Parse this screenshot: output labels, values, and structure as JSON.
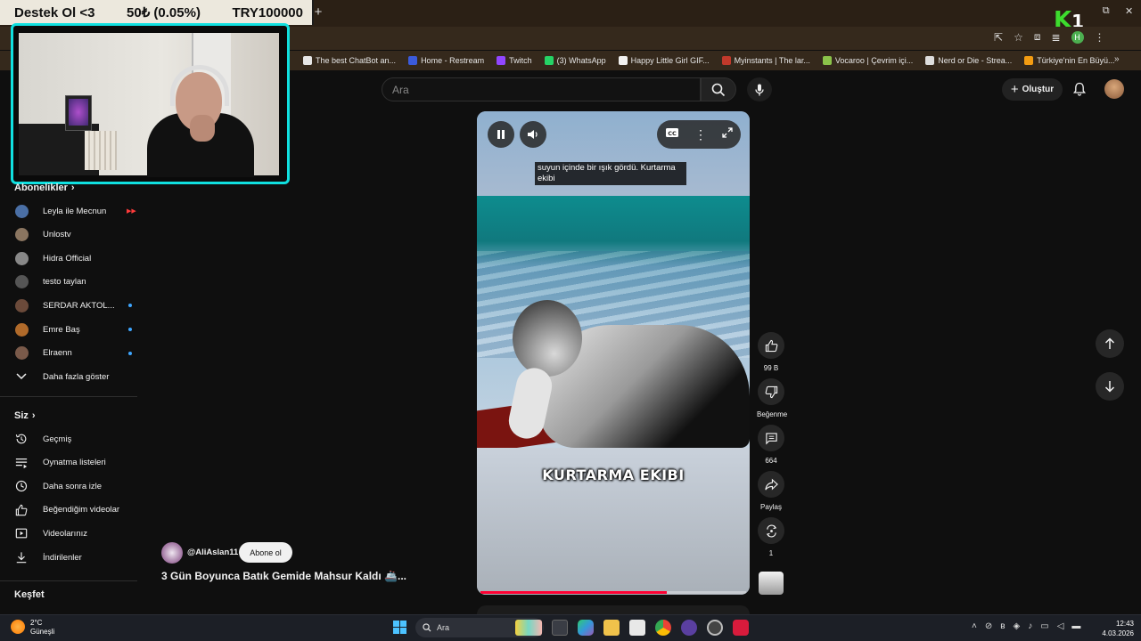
{
  "overlay": {
    "donation_label": "Destek Ol <3",
    "donation_amount": "50₺ (0.05%)",
    "donation_goal": "TRY100000",
    "new_tab": "+"
  },
  "bookmarks": [
    {
      "label": "The best ChatBot an...",
      "color": "#e6e6e6"
    },
    {
      "label": "Home - Restream",
      "color": "#3b5bdb"
    },
    {
      "label": "Twitch",
      "color": "#9146ff"
    },
    {
      "label": "(3) WhatsApp",
      "color": "#25d366"
    },
    {
      "label": "Happy Little Girl GIF...",
      "color": "#f1f1f1"
    },
    {
      "label": "Myinstants | The lar...",
      "color": "#c0392b"
    },
    {
      "label": "Vocaroo | Çevrim içi...",
      "color": "#8bc34a"
    },
    {
      "label": "Nerd or Die - Strea...",
      "color": "#dddddd"
    },
    {
      "label": "Türkiye'nin En Büyü...",
      "color": "#f39c12"
    }
  ],
  "bookmarks_more": "»",
  "header": {
    "search_placeholder": "Ara",
    "create_label": "Oluştur",
    "profile_initial": "H"
  },
  "sidebar": {
    "subscriptions_title": "Abonelikler",
    "channels": [
      {
        "name": "Leyla ile Mecnun",
        "color": "#4a6fa5",
        "live": true,
        "dot": false
      },
      {
        "name": "Unlostv",
        "color": "#8a7560",
        "live": false,
        "dot": false
      },
      {
        "name": "Hidra Official",
        "color": "#888888",
        "live": false,
        "dot": false
      },
      {
        "name": "testo taylan",
        "color": "#555555",
        "live": false,
        "dot": false
      },
      {
        "name": "SERDAR AKTOL...",
        "color": "#6b4a3a",
        "live": false,
        "dot": true
      },
      {
        "name": "Emre Baş",
        "color": "#b06a2a",
        "live": false,
        "dot": true
      },
      {
        "name": "Elraenn",
        "color": "#7a5a4a",
        "live": false,
        "dot": true
      }
    ],
    "show_more": "Daha fazla göster",
    "you_title": "Siz",
    "you_items": [
      {
        "label": "Geçmiş",
        "icon": "history-icon"
      },
      {
        "label": "Oynatma listeleri",
        "icon": "playlist-icon"
      },
      {
        "label": "Daha sonra izle",
        "icon": "clock-icon"
      },
      {
        "label": "Beğendiğim videolar",
        "icon": "thumbs-up-icon"
      },
      {
        "label": "Videolarınız",
        "icon": "video-icon"
      },
      {
        "label": "İndirilenler",
        "icon": "download-icon"
      }
    ],
    "explore_title": "Keşfet"
  },
  "player": {
    "caption": "suyun içinde bir ışık gördü. Kurtarma ekibi",
    "overlay_text": "KURTARMA EKIBI",
    "progress_fraction": 0.7
  },
  "actions": {
    "like_count": "99 B",
    "dislike_label": "Beğenme",
    "comment_count": "664",
    "share_label": "Paylaş",
    "remix_count": "1"
  },
  "channel": {
    "handle": "@AliAslan11",
    "subscribe_label": "Abone ol",
    "video_title": "3 Gün Boyunca Batık Gemide Mahsur Kaldı 🚢..."
  },
  "taskbar": {
    "temperature": "2°C",
    "weather": "Güneşli",
    "search_label": "Ara",
    "time": "12:43",
    "date": "4.03.2026"
  },
  "colors": {
    "accent_red": "#ff0033",
    "webcam_border": "#10e0e0",
    "logo_green": "#3ddc2e"
  }
}
